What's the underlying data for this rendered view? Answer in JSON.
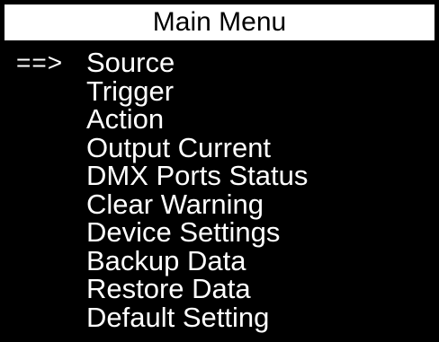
{
  "header": {
    "title": "Main Menu"
  },
  "menu": {
    "cursor": "==>",
    "selected_index": 0,
    "items": [
      {
        "label": "Source"
      },
      {
        "label": "Trigger"
      },
      {
        "label": "Action"
      },
      {
        "label": "Output Current"
      },
      {
        "label": "DMX Ports Status"
      },
      {
        "label": "Clear Warning"
      },
      {
        "label": "Device Settings"
      },
      {
        "label": "Backup Data"
      },
      {
        "label": "Restore Data"
      },
      {
        "label": "Default Setting"
      }
    ]
  },
  "colors": {
    "background": "#000000",
    "foreground": "#ffffff",
    "title_background": "#ffffff",
    "title_text": "#000000"
  }
}
